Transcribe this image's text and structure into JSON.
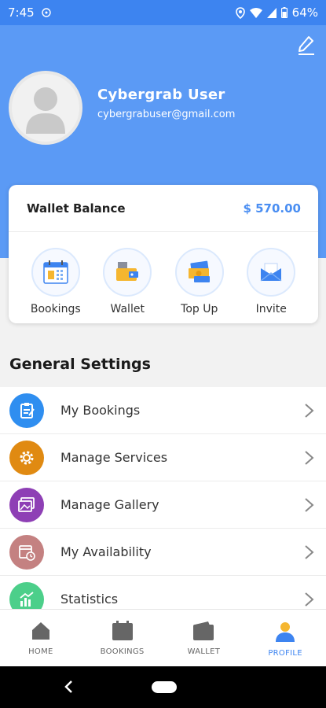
{
  "status_bar": {
    "time": "7:45",
    "battery": "64%"
  },
  "profile": {
    "name": "Cybergrab  User",
    "email": "cybergrabuser@gmail.com"
  },
  "wallet": {
    "label": "Wallet Balance",
    "amount": "$ 570.00",
    "actions": [
      {
        "label": "Bookings",
        "icon": "calendar-icon"
      },
      {
        "label": "Wallet",
        "icon": "wallet-icon"
      },
      {
        "label": "Top Up",
        "icon": "money-icon"
      },
      {
        "label": "Invite",
        "icon": "envelope-icon"
      }
    ]
  },
  "general_settings": {
    "title": "General Settings",
    "items": [
      {
        "label": "My Bookings",
        "icon": "clipboard-icon",
        "color": "#2f8ef0"
      },
      {
        "label": "Manage Services",
        "icon": "gear-icon",
        "color": "#e08a12"
      },
      {
        "label": "Manage Gallery",
        "icon": "gallery-icon",
        "color": "#8e3fb5"
      },
      {
        "label": "My Availability",
        "icon": "calendar-clock-icon",
        "color": "#c48181"
      },
      {
        "label": "Statistics",
        "icon": "chart-icon",
        "color": "#4ccf8a"
      }
    ]
  },
  "bottom_nav": {
    "items": [
      {
        "label": "HOME",
        "icon": "home-icon"
      },
      {
        "label": "BOOKINGS",
        "icon": "bookings-icon"
      },
      {
        "label": "WALLET",
        "icon": "wallet-icon"
      },
      {
        "label": "PROFILE",
        "icon": "profile-icon",
        "active": true
      }
    ]
  },
  "colors": {
    "primary": "#3d84f0",
    "header": "#5b9af5",
    "amount": "#4a8ef2"
  }
}
